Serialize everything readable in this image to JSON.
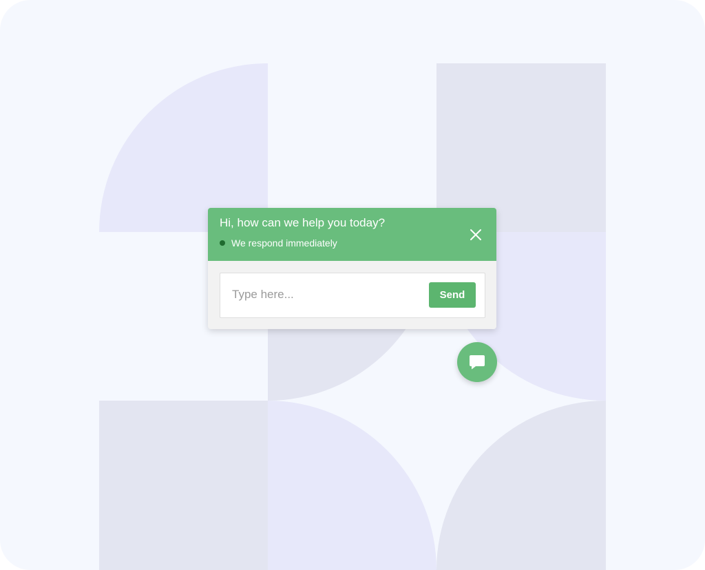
{
  "colors": {
    "page_background": "#f5f8fe",
    "accent_green": "#69bd7d",
    "button_green": "#5cb56f",
    "status_dot": "#1f6b2f",
    "shape_lavender": "#e7e8fa",
    "shape_grey": "#e3e5f1"
  },
  "chat": {
    "title": "Hi, how can we help you today?",
    "status_text": "We respond immediately",
    "close_icon": "close-icon",
    "input": {
      "placeholder": "Type here...",
      "value": ""
    },
    "send_label": "Send"
  },
  "launcher": {
    "icon": "chat-bubble-icon"
  }
}
